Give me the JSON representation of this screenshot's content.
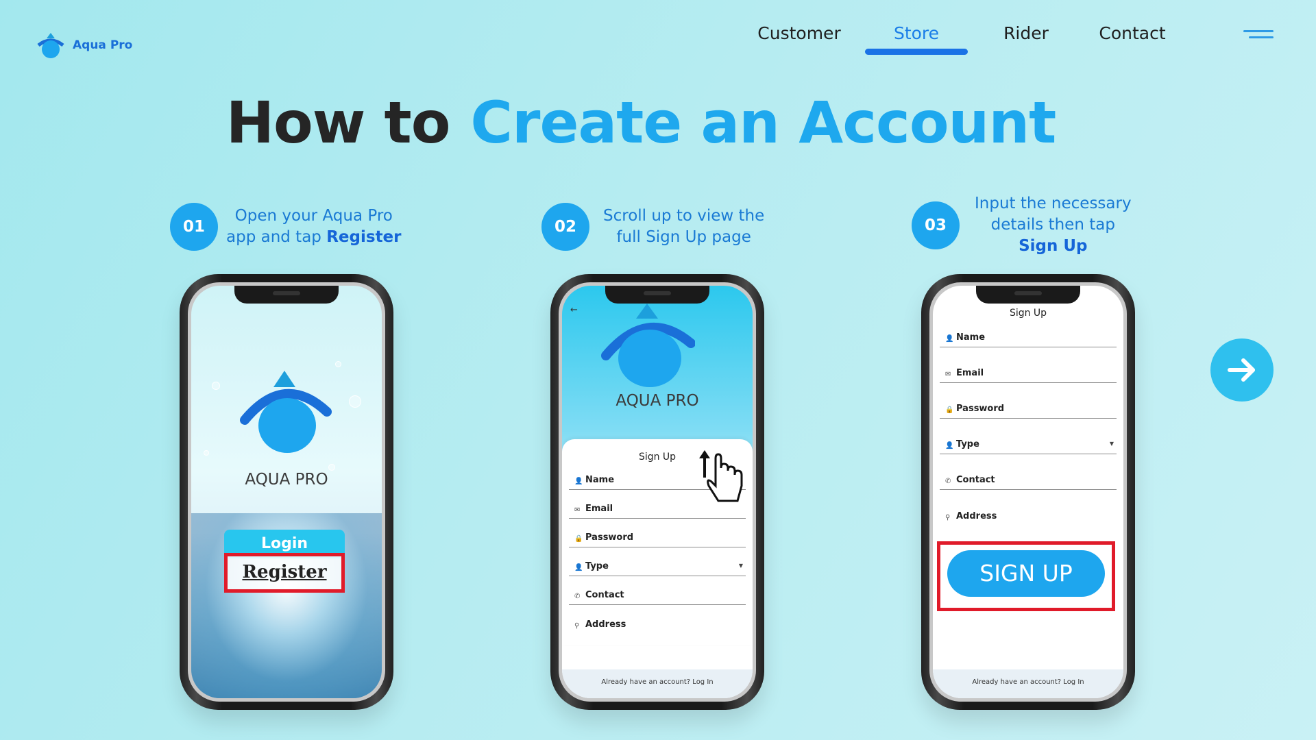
{
  "brand": {
    "name": "Aqua Pro"
  },
  "nav": {
    "items": [
      "Customer",
      "Store",
      "Rider",
      "Contact"
    ],
    "active": "Store"
  },
  "title": {
    "dark": "How to",
    "blue": "Create an Account"
  },
  "steps": [
    {
      "num": "01",
      "line1": "Open your Aqua Pro",
      "line2_pre": "app and tap ",
      "line2_bold": "Register"
    },
    {
      "num": "02",
      "line1": "Scroll up to view the",
      "line2": "full Sign Up page"
    },
    {
      "num": "03",
      "line1": "Input the necessary",
      "line2": "details then tap",
      "line3_bold": "Sign Up"
    }
  ],
  "phone1": {
    "app_name": "AQUA PRO",
    "login": "Login",
    "register": "Register"
  },
  "phone2": {
    "app_name": "AQUA PRO",
    "form_title": "Sign Up",
    "fields": [
      "Name",
      "Email",
      "Password",
      "Type",
      "Contact",
      "Address"
    ],
    "footer": "Already have an account? Log In"
  },
  "phone3": {
    "form_title": "Sign Up",
    "fields": [
      "Name",
      "Email",
      "Password",
      "Type",
      "Contact",
      "Address"
    ],
    "signup": "SIGN UP",
    "footer": "Already have an account? Log In"
  },
  "colors": {
    "accent": "#1ea6ee",
    "highlight": "#e01b2a",
    "nav_active": "#1a72e6"
  }
}
